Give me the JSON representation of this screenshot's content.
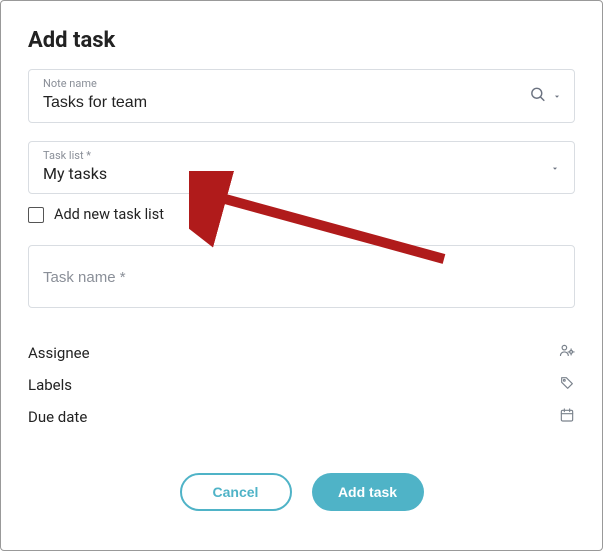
{
  "modal": {
    "title": "Add task"
  },
  "fields": {
    "note_name": {
      "label": "Note name",
      "value": "Tasks for team"
    },
    "task_list": {
      "label": "Task list *",
      "value": "My tasks"
    },
    "add_new_list": {
      "label": "Add new task list",
      "checked": false
    },
    "task_name": {
      "placeholder": "Task name *",
      "value": ""
    }
  },
  "meta": {
    "assignee": {
      "label": "Assignee"
    },
    "labels": {
      "label": "Labels"
    },
    "due_date": {
      "label": "Due date"
    }
  },
  "buttons": {
    "cancel": "Cancel",
    "submit": "Add task"
  }
}
